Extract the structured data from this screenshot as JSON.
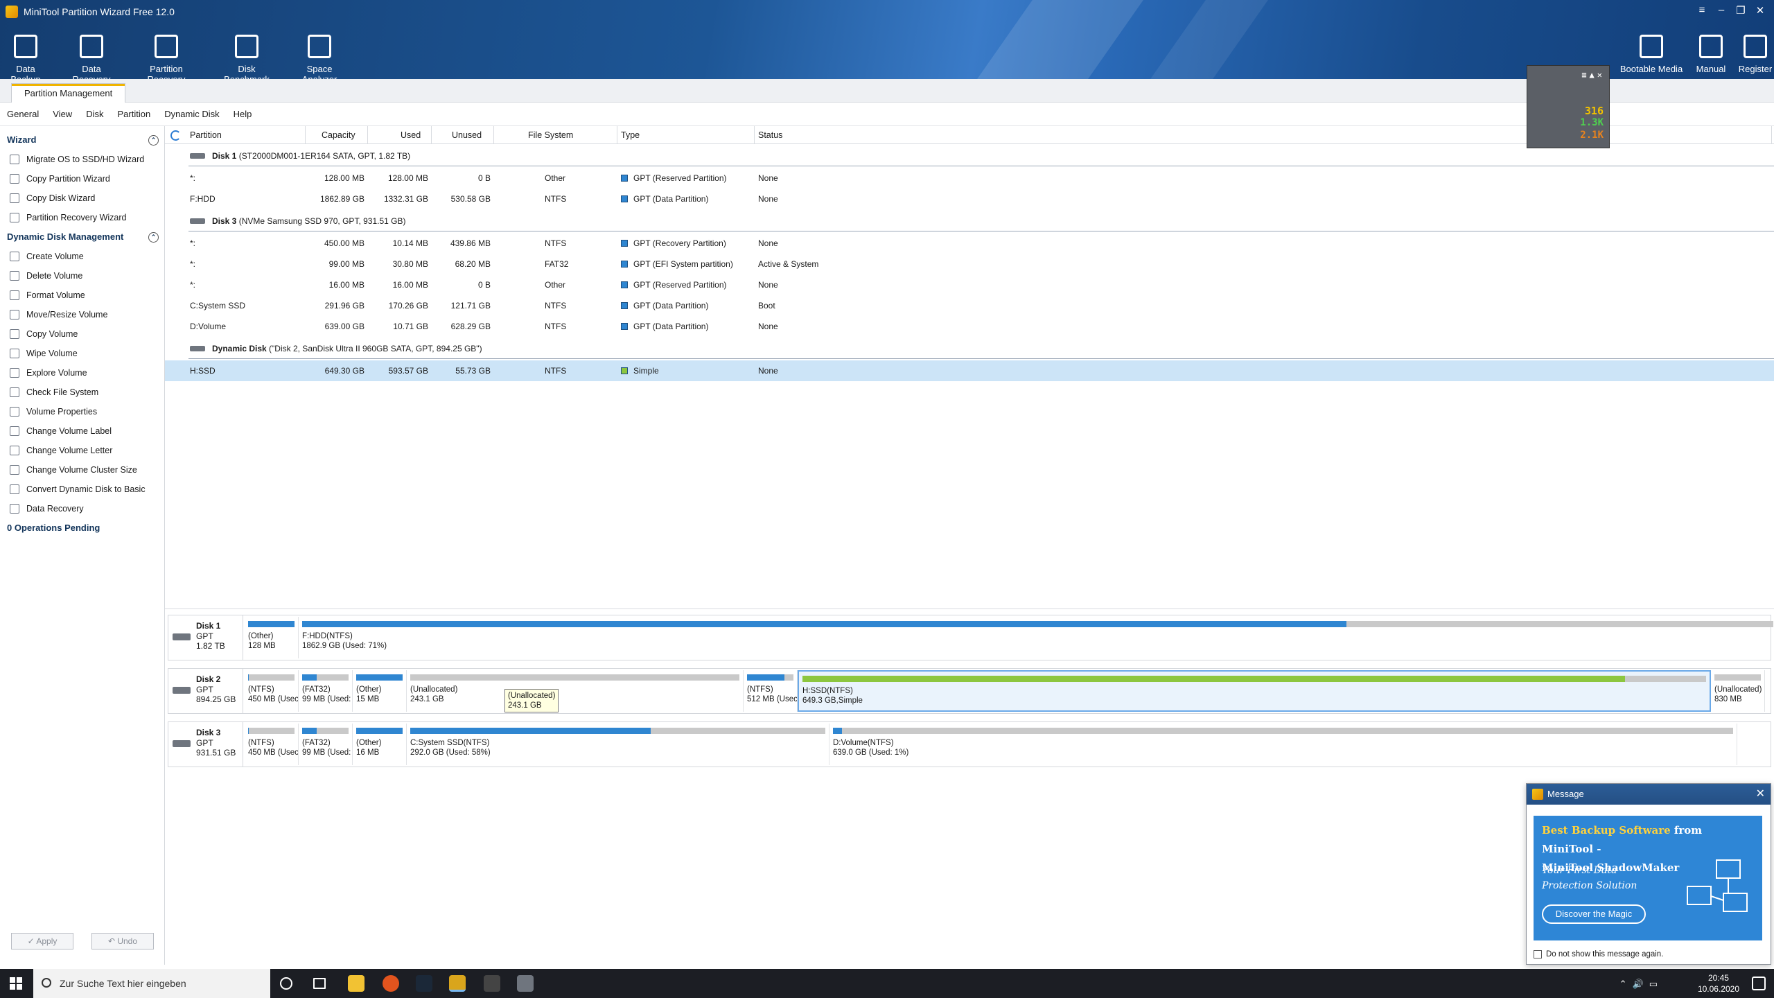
{
  "app": {
    "title": "MiniTool Partition Wizard Free 12.0"
  },
  "toolbar": {
    "left": [
      "Data Backup",
      "Data Recovery",
      "Partition Recovery",
      "Disk Benchmark",
      "Space Analyzer"
    ],
    "right": [
      "Bootable Media",
      "Manual",
      "Register"
    ]
  },
  "tab": {
    "label": "Partition Management"
  },
  "menu": [
    "General",
    "View",
    "Disk",
    "Partition",
    "Dynamic Disk",
    "Help"
  ],
  "sidebar": {
    "wizard_title": "Wizard",
    "wizard_items": [
      "Migrate OS to SSD/HD Wizard",
      "Copy Partition Wizard",
      "Copy Disk Wizard",
      "Partition Recovery Wizard"
    ],
    "dyn_title": "Dynamic Disk Management",
    "dyn_items": [
      "Create Volume",
      "Delete Volume",
      "Format Volume",
      "Move/Resize Volume",
      "Copy Volume",
      "Wipe Volume",
      "Explore Volume",
      "Check File System",
      "Volume Properties",
      "Change Volume Label",
      "Change Volume Letter",
      "Change Volume Cluster Size",
      "Convert Dynamic Disk to Basic",
      "Data Recovery"
    ],
    "pending": "0 Operations Pending",
    "apply": "✓ Apply",
    "undo": "↶ Undo"
  },
  "table": {
    "headers": [
      "Partition",
      "Capacity",
      "Used",
      "Unused",
      "File System",
      "Type",
      "Status"
    ],
    "groups": [
      {
        "disk_name": "Disk 1",
        "disk_info": "(ST2000DM001-1ER164 SATA, GPT, 1.82 TB)",
        "rows": [
          {
            "partition": "*:",
            "capacity": "128.00 MB",
            "used": "128.00 MB",
            "unused": "0 B",
            "fs": "Other",
            "type": "GPT (Reserved Partition)",
            "status": "None"
          },
          {
            "partition": "F:HDD",
            "capacity": "1862.89 GB",
            "used": "1332.31 GB",
            "unused": "530.58 GB",
            "fs": "NTFS",
            "type": "GPT (Data Partition)",
            "status": "None"
          }
        ]
      },
      {
        "disk_name": "Disk 3",
        "disk_info": "(NVMe Samsung SSD 970, GPT, 931.51 GB)",
        "rows": [
          {
            "partition": "*:",
            "capacity": "450.00 MB",
            "used": "10.14 MB",
            "unused": "439.86 MB",
            "fs": "NTFS",
            "type": "GPT (Recovery Partition)",
            "status": "None"
          },
          {
            "partition": "*:",
            "capacity": "99.00 MB",
            "used": "30.80 MB",
            "unused": "68.20 MB",
            "fs": "FAT32",
            "type": "GPT (EFI System partition)",
            "status": "Active & System"
          },
          {
            "partition": "*:",
            "capacity": "16.00 MB",
            "used": "16.00 MB",
            "unused": "0 B",
            "fs": "Other",
            "type": "GPT (Reserved Partition)",
            "status": "None"
          },
          {
            "partition": "C:System SSD",
            "capacity": "291.96 GB",
            "used": "170.26 GB",
            "unused": "121.71 GB",
            "fs": "NTFS",
            "type": "GPT (Data Partition)",
            "status": "Boot"
          },
          {
            "partition": "D:Volume",
            "capacity": "639.00 GB",
            "used": "10.71 GB",
            "unused": "628.29 GB",
            "fs": "NTFS",
            "type": "GPT (Data Partition)",
            "status": "None"
          }
        ]
      },
      {
        "disk_name": "Dynamic Disk",
        "disk_info": "(\"Disk 2, SanDisk Ultra II 960GB SATA, GPT, 894.25 GB\")",
        "rows": [
          {
            "partition": "H:SSD",
            "capacity": "649.30 GB",
            "used": "593.57 GB",
            "unused": "55.73 GB",
            "fs": "NTFS",
            "type": "Simple",
            "status": "None",
            "selected": true
          }
        ]
      }
    ]
  },
  "diskmap": [
    {
      "name": "Disk 1",
      "style": "GPT",
      "size": "1.82 TB",
      "segments": [
        {
          "l1": "(Other)",
          "l2": "128 MB",
          "used_pct": 100
        },
        {
          "l1": "F:HDD(NTFS)",
          "l2": "1862.9 GB (Used: 71%)",
          "used_pct": 71
        }
      ]
    },
    {
      "name": "Disk 2",
      "style": "GPT",
      "size": "894.25 GB",
      "segments": [
        {
          "l1": "(NTFS)",
          "l2": "450 MB (Usec",
          "used_pct": 2
        },
        {
          "l1": "(FAT32)",
          "l2": "99 MB (Used:",
          "used_pct": 31
        },
        {
          "l1": "(Other)",
          "l2": "15 MB",
          "used_pct": 100
        },
        {
          "l1": "(Unallocated)",
          "l2": "243.1 GB",
          "used_pct": 0
        },
        {
          "l1": "(NTFS)",
          "l2": "512 MB (Usec",
          "used_pct": 80
        },
        {
          "l1": "H:SSD(NTFS)",
          "l2": "649.3 GB,Simple",
          "used_pct": 91,
          "color": "#8cc63f",
          "selected": true
        },
        {
          "l1": "(Unallocated)",
          "l2": "830 MB",
          "used_pct": 0
        }
      ]
    },
    {
      "name": "Disk 3",
      "style": "GPT",
      "size": "931.51 GB",
      "segments": [
        {
          "l1": "(NTFS)",
          "l2": "450 MB (Usec",
          "used_pct": 2
        },
        {
          "l1": "(FAT32)",
          "l2": "99 MB (Used:",
          "used_pct": 31
        },
        {
          "l1": "(Other)",
          "l2": "16 MB",
          "used_pct": 100
        },
        {
          "l1": "C:System SSD(NTFS)",
          "l2": "292.0 GB (Used: 58%)",
          "used_pct": 58
        },
        {
          "l1": "D:Volume(NTFS)",
          "l2": "639.0 GB (Used: 1%)",
          "used_pct": 1
        }
      ]
    }
  ],
  "tooltip": {
    "l1": "(Unallocated)",
    "l2": "243.1 GB"
  },
  "widget": {
    "v1": "316",
    "v2": "1.3K",
    "v3": "2.1K"
  },
  "message": {
    "title": "Message",
    "headline_a": "Best Backup Software",
    "headline_b": "from MiniTool -",
    "headline_c": "MiniTool ShadowMaker",
    "sub1": "Your First Data",
    "sub2": "Protection Solution",
    "button": "Discover the Magic",
    "checkbox": "Do not show this message again."
  },
  "taskbar": {
    "search_placeholder": "Zur Suche Text hier eingeben",
    "time": "20:45",
    "date": "10.06.2020"
  },
  "colors": {
    "accent": "#2f86d1",
    "selected_row": "#cce4f7",
    "used_bar_dynamic": "#8cc63f",
    "titlebar": "#1d5696"
  }
}
